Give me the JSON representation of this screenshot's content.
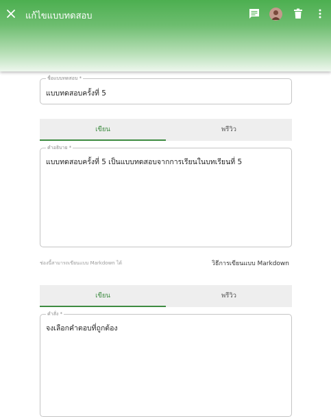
{
  "header": {
    "title": "แก้ไขแบบทดสอบ",
    "icons": [
      "close-icon",
      "comment-icon",
      "avatar",
      "delete-icon",
      "more-vert-icon"
    ],
    "color": "#4caf50"
  },
  "name_field": {
    "label": "ชื่อแบบทดสอบ *",
    "value": "แบบทดสอบครั้งที่ 5"
  },
  "description_tabs": {
    "write_label": "เขียน",
    "preview_label": "พรีวิว"
  },
  "description_field": {
    "label": "คำอธิบาย *",
    "value": "แบบทดสอบครั้งที่ 5 เป็นแบบทดสอบจากการเรียนในบทเรียนที่ 5"
  },
  "markdown_hint": {
    "text": "ช่องนี้สามารถเขียนแบบ Markdown ได้",
    "link_label": "วิธีการเขียนแบบ Markdown"
  },
  "instruction_tabs": {
    "write_label": "เขียน",
    "preview_label": "พรีวิว"
  },
  "instruction_field": {
    "label": "คำสั่ง *",
    "value": "จงเลือกคำตอบที่ถูกต้อง"
  },
  "accent_color": "#3d8b40"
}
